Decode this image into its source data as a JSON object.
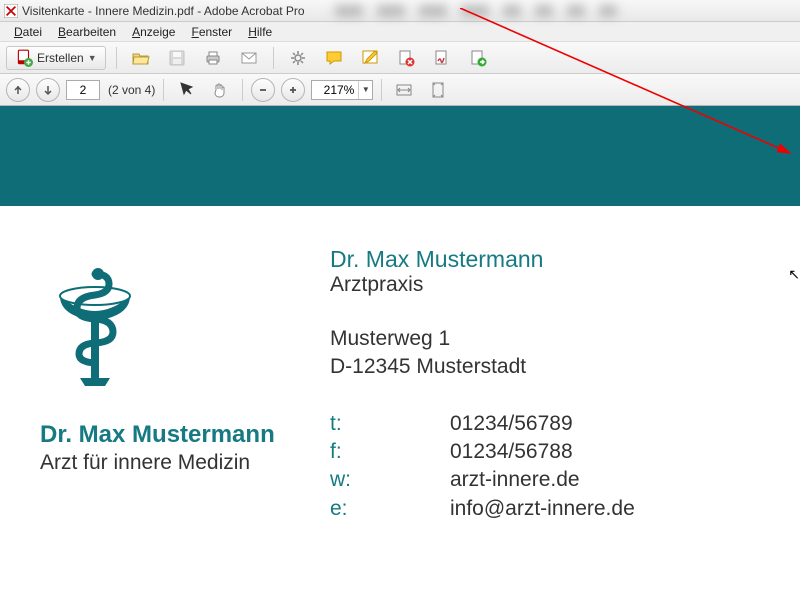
{
  "window": {
    "title": "Visitenkarte - Innere Medizin.pdf - Adobe Acrobat Pro"
  },
  "menubar": {
    "file": "Datei",
    "edit": "Bearbeiten",
    "view": "Anzeige",
    "window": "Fenster",
    "help": "Hilfe"
  },
  "toolbar": {
    "create": "Erstellen"
  },
  "nav": {
    "page": "2",
    "page_count": "(2 von 4)",
    "zoom": "217%"
  },
  "card": {
    "left_name": "Dr. Max Mustermann",
    "left_sub": "Arzt für innere Medizin",
    "right_name": "Dr. Max Mustermann",
    "right_sub": "Arztpraxis",
    "addr1": "Musterweg 1",
    "addr2": "D-12345 Musterstadt",
    "t_label": "t:",
    "t_value": "01234/56789",
    "f_label": "f:",
    "f_value": "01234/56788",
    "w_label": "w:",
    "w_value": "arzt-innere.de",
    "e_label": "e:",
    "e_value": "info@arzt-innere.de"
  },
  "colors": {
    "teal": "#0e6d76",
    "teal_text": "#167a83"
  }
}
